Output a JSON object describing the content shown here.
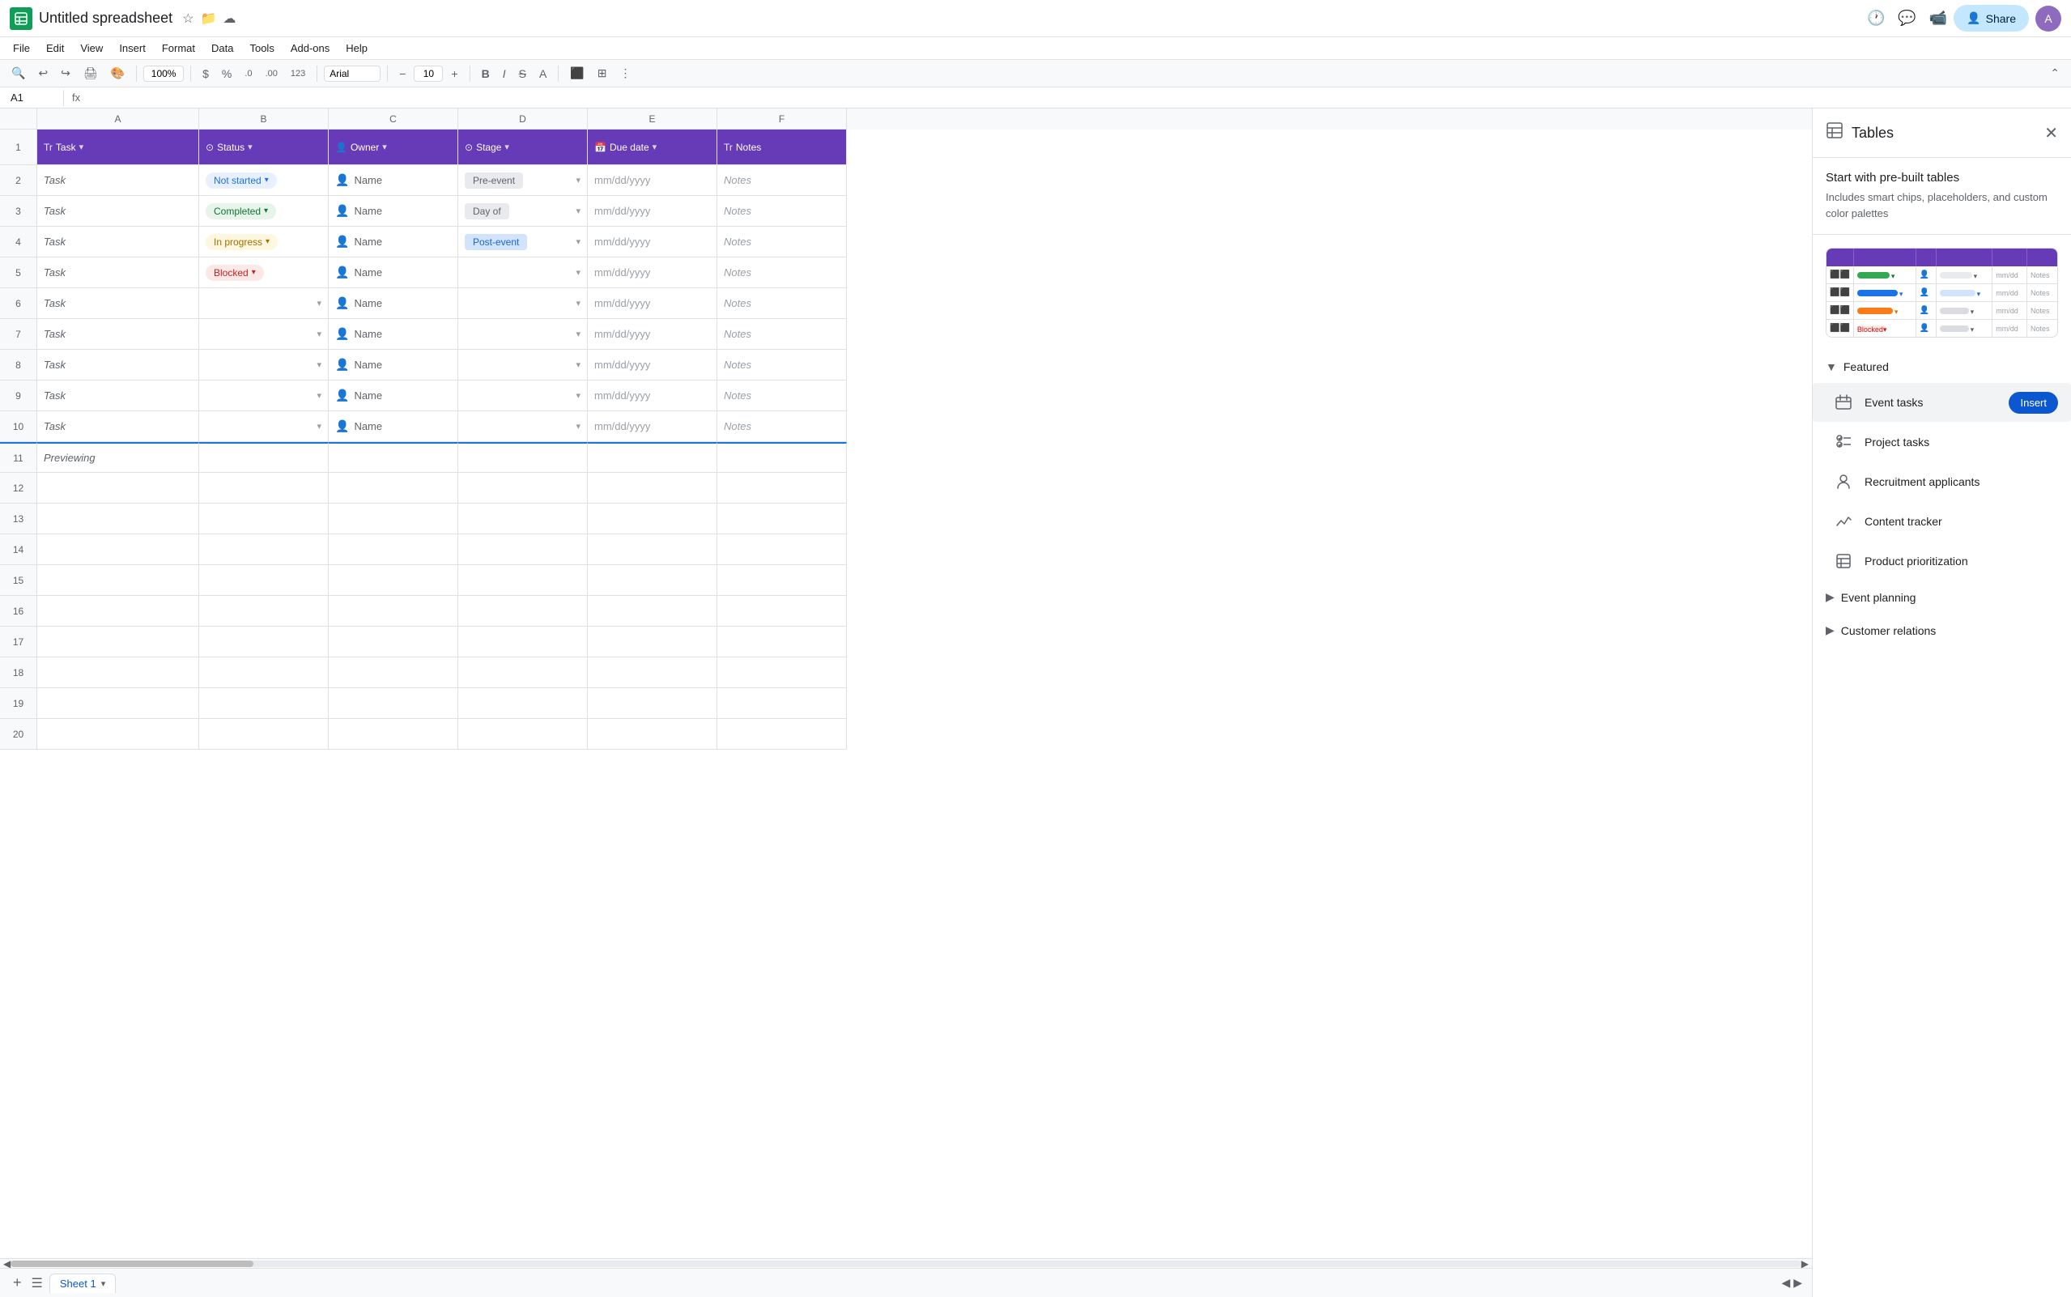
{
  "app": {
    "icon": "S",
    "title": "Untitled spreadsheet",
    "menu": [
      "File",
      "Edit",
      "View",
      "Insert",
      "Format",
      "Data",
      "Tools",
      "Add-ons",
      "Help"
    ],
    "zoom": "100%",
    "font_family": "Arial",
    "font_size": "10",
    "cell_ref": "A1",
    "share_label": "Share"
  },
  "toolbar": {
    "undo": "↩",
    "redo": "↪",
    "print": "🖨",
    "paint": "🪣",
    "zoom_label": "100%",
    "currency": "$",
    "percent": "%",
    "decimal_dec": ".0",
    "decimal_inc": ".00",
    "number": "123",
    "font": "Arial",
    "font_size": "10",
    "font_size_dec": "−",
    "font_size_inc": "+",
    "bold": "B",
    "italic": "I",
    "strikethrough": "S̶",
    "text_color": "A",
    "fill_color": "🎨",
    "borders": "⊞",
    "more": "⋮",
    "collapse": "⌃"
  },
  "headers": {
    "col_a": "Task",
    "col_b": "Status",
    "col_c": "Owner",
    "col_d": "Stage",
    "col_e": "Due date",
    "col_f": "Notes"
  },
  "rows": [
    {
      "num": 2,
      "task": "Task",
      "status": "Not started",
      "status_type": "not-started",
      "owner": "Name",
      "stage": "Pre-event",
      "stage_type": "pre",
      "due": "mm/dd/yyyy",
      "notes": "Notes"
    },
    {
      "num": 3,
      "task": "Task",
      "status": "Completed",
      "status_type": "completed",
      "owner": "Name",
      "stage": "Day of",
      "stage_type": "day",
      "due": "mm/dd/yyyy",
      "notes": "Notes"
    },
    {
      "num": 4,
      "task": "Task",
      "status": "In progress",
      "status_type": "in-progress",
      "owner": "Name",
      "stage": "Post-event",
      "stage_type": "post",
      "due": "mm/dd/yyyy",
      "notes": "Notes"
    },
    {
      "num": 5,
      "task": "Task",
      "status": "Blocked",
      "status_type": "blocked",
      "owner": "Name",
      "stage": "",
      "stage_type": "empty",
      "due": "mm/dd/yyyy",
      "notes": "Notes"
    },
    {
      "num": 6,
      "task": "Task",
      "status": "",
      "status_type": "empty",
      "owner": "Name",
      "stage": "",
      "stage_type": "empty",
      "due": "mm/dd/yyyy",
      "notes": "Notes"
    },
    {
      "num": 7,
      "task": "Task",
      "status": "",
      "status_type": "empty",
      "owner": "Name",
      "stage": "",
      "stage_type": "empty",
      "due": "mm/dd/yyyy",
      "notes": "Notes"
    },
    {
      "num": 8,
      "task": "Task",
      "status": "",
      "status_type": "empty",
      "owner": "Name",
      "stage": "",
      "stage_type": "empty",
      "due": "mm/dd/yyyy",
      "notes": "Notes"
    },
    {
      "num": 9,
      "task": "Task",
      "status": "",
      "status_type": "empty",
      "owner": "Name",
      "stage": "",
      "stage_type": "empty",
      "due": "mm/dd/yyyy",
      "notes": "Notes"
    },
    {
      "num": 10,
      "task": "Task",
      "status": "",
      "status_type": "empty",
      "owner": "Name",
      "stage": "",
      "stage_type": "empty",
      "due": "mm/dd/yyyy",
      "notes": "Notes"
    }
  ],
  "preview": {
    "text": "Previewing",
    "row_num": 11
  },
  "empty_rows": [
    12,
    13,
    14,
    15,
    16,
    17,
    18,
    19,
    20
  ],
  "sheet_tab": "Sheet 1",
  "panel": {
    "title": "Tables",
    "intro_title": "Start with pre-built tables",
    "intro_text": "Includes smart chips, placeholders, and custom color palettes",
    "sections": [
      {
        "name": "Featured",
        "expanded": true,
        "items": [
          {
            "name": "Event tasks",
            "icon": "checklist",
            "has_insert": true
          },
          {
            "name": "Project tasks",
            "icon": "checklist-check"
          },
          {
            "name": "Recruitment applicants",
            "icon": "person"
          },
          {
            "name": "Content tracker",
            "icon": "trend"
          },
          {
            "name": "Product prioritization",
            "icon": "table"
          }
        ]
      },
      {
        "name": "Event planning",
        "expanded": false,
        "items": []
      },
      {
        "name": "Customer relations",
        "expanded": false,
        "items": []
      }
    ]
  }
}
